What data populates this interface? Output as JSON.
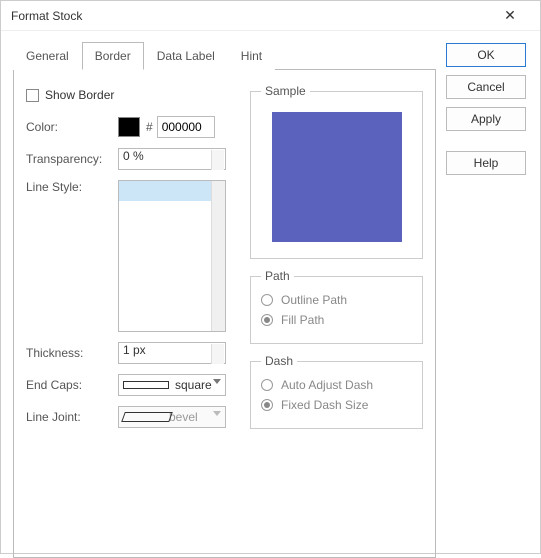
{
  "window": {
    "title": "Format Stock",
    "close": "✕"
  },
  "buttons": {
    "ok": "OK",
    "cancel": "Cancel",
    "apply": "Apply",
    "help": "Help"
  },
  "tabs": [
    "General",
    "Border",
    "Data Label",
    "Hint"
  ],
  "activeTab": "Border",
  "border": {
    "showBorderLabel": "Show Border",
    "colorLabel": "Color:",
    "hash": "#",
    "colorHex": "000000",
    "transparencyLabel": "Transparency:",
    "transparencyValue": "0 %",
    "lineStyleLabel": "Line Style:",
    "thicknessLabel": "Thickness:",
    "thicknessValue": "1 px",
    "endCapsLabel": "End Caps:",
    "endCapsValue": "square",
    "lineJointLabel": "Line Joint:",
    "lineJointValue": "bevel"
  },
  "sample": {
    "legend": "Sample",
    "color": "#5b62bd"
  },
  "path": {
    "legend": "Path",
    "outline": "Outline Path",
    "fill": "Fill Path",
    "selected": "fill"
  },
  "dash": {
    "legend": "Dash",
    "auto": "Auto Adjust Dash",
    "fixed": "Fixed Dash Size",
    "selected": "fixed"
  }
}
